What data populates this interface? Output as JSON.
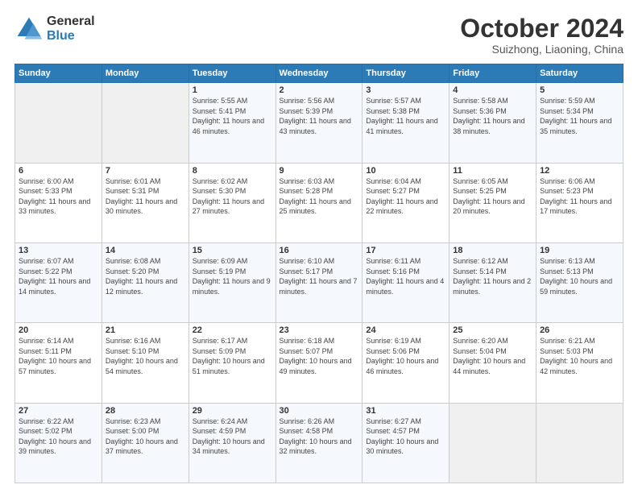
{
  "logo": {
    "general": "General",
    "blue": "Blue"
  },
  "header": {
    "month": "October 2024",
    "location": "Suizhong, Liaoning, China"
  },
  "days_of_week": [
    "Sunday",
    "Monday",
    "Tuesday",
    "Wednesday",
    "Thursday",
    "Friday",
    "Saturday"
  ],
  "weeks": [
    [
      {
        "day": "",
        "empty": true
      },
      {
        "day": "",
        "empty": true
      },
      {
        "day": "1",
        "sunrise": "5:55 AM",
        "sunset": "5:41 PM",
        "daylight": "11 hours and 46 minutes."
      },
      {
        "day": "2",
        "sunrise": "5:56 AM",
        "sunset": "5:39 PM",
        "daylight": "11 hours and 43 minutes."
      },
      {
        "day": "3",
        "sunrise": "5:57 AM",
        "sunset": "5:38 PM",
        "daylight": "11 hours and 41 minutes."
      },
      {
        "day": "4",
        "sunrise": "5:58 AM",
        "sunset": "5:36 PM",
        "daylight": "11 hours and 38 minutes."
      },
      {
        "day": "5",
        "sunrise": "5:59 AM",
        "sunset": "5:34 PM",
        "daylight": "11 hours and 35 minutes."
      }
    ],
    [
      {
        "day": "6",
        "sunrise": "6:00 AM",
        "sunset": "5:33 PM",
        "daylight": "11 hours and 33 minutes."
      },
      {
        "day": "7",
        "sunrise": "6:01 AM",
        "sunset": "5:31 PM",
        "daylight": "11 hours and 30 minutes."
      },
      {
        "day": "8",
        "sunrise": "6:02 AM",
        "sunset": "5:30 PM",
        "daylight": "11 hours and 27 minutes."
      },
      {
        "day": "9",
        "sunrise": "6:03 AM",
        "sunset": "5:28 PM",
        "daylight": "11 hours and 25 minutes."
      },
      {
        "day": "10",
        "sunrise": "6:04 AM",
        "sunset": "5:27 PM",
        "daylight": "11 hours and 22 minutes."
      },
      {
        "day": "11",
        "sunrise": "6:05 AM",
        "sunset": "5:25 PM",
        "daylight": "11 hours and 20 minutes."
      },
      {
        "day": "12",
        "sunrise": "6:06 AM",
        "sunset": "5:23 PM",
        "daylight": "11 hours and 17 minutes."
      }
    ],
    [
      {
        "day": "13",
        "sunrise": "6:07 AM",
        "sunset": "5:22 PM",
        "daylight": "11 hours and 14 minutes."
      },
      {
        "day": "14",
        "sunrise": "6:08 AM",
        "sunset": "5:20 PM",
        "daylight": "11 hours and 12 minutes."
      },
      {
        "day": "15",
        "sunrise": "6:09 AM",
        "sunset": "5:19 PM",
        "daylight": "11 hours and 9 minutes."
      },
      {
        "day": "16",
        "sunrise": "6:10 AM",
        "sunset": "5:17 PM",
        "daylight": "11 hours and 7 minutes."
      },
      {
        "day": "17",
        "sunrise": "6:11 AM",
        "sunset": "5:16 PM",
        "daylight": "11 hours and 4 minutes."
      },
      {
        "day": "18",
        "sunrise": "6:12 AM",
        "sunset": "5:14 PM",
        "daylight": "11 hours and 2 minutes."
      },
      {
        "day": "19",
        "sunrise": "6:13 AM",
        "sunset": "5:13 PM",
        "daylight": "10 hours and 59 minutes."
      }
    ],
    [
      {
        "day": "20",
        "sunrise": "6:14 AM",
        "sunset": "5:11 PM",
        "daylight": "10 hours and 57 minutes."
      },
      {
        "day": "21",
        "sunrise": "6:16 AM",
        "sunset": "5:10 PM",
        "daylight": "10 hours and 54 minutes."
      },
      {
        "day": "22",
        "sunrise": "6:17 AM",
        "sunset": "5:09 PM",
        "daylight": "10 hours and 51 minutes."
      },
      {
        "day": "23",
        "sunrise": "6:18 AM",
        "sunset": "5:07 PM",
        "daylight": "10 hours and 49 minutes."
      },
      {
        "day": "24",
        "sunrise": "6:19 AM",
        "sunset": "5:06 PM",
        "daylight": "10 hours and 46 minutes."
      },
      {
        "day": "25",
        "sunrise": "6:20 AM",
        "sunset": "5:04 PM",
        "daylight": "10 hours and 44 minutes."
      },
      {
        "day": "26",
        "sunrise": "6:21 AM",
        "sunset": "5:03 PM",
        "daylight": "10 hours and 42 minutes."
      }
    ],
    [
      {
        "day": "27",
        "sunrise": "6:22 AM",
        "sunset": "5:02 PM",
        "daylight": "10 hours and 39 minutes."
      },
      {
        "day": "28",
        "sunrise": "6:23 AM",
        "sunset": "5:00 PM",
        "daylight": "10 hours and 37 minutes."
      },
      {
        "day": "29",
        "sunrise": "6:24 AM",
        "sunset": "4:59 PM",
        "daylight": "10 hours and 34 minutes."
      },
      {
        "day": "30",
        "sunrise": "6:26 AM",
        "sunset": "4:58 PM",
        "daylight": "10 hours and 32 minutes."
      },
      {
        "day": "31",
        "sunrise": "6:27 AM",
        "sunset": "4:57 PM",
        "daylight": "10 hours and 30 minutes."
      },
      {
        "day": "",
        "empty": true
      },
      {
        "day": "",
        "empty": true
      }
    ]
  ],
  "labels": {
    "sunrise": "Sunrise:",
    "sunset": "Sunset:",
    "daylight": "Daylight:"
  }
}
